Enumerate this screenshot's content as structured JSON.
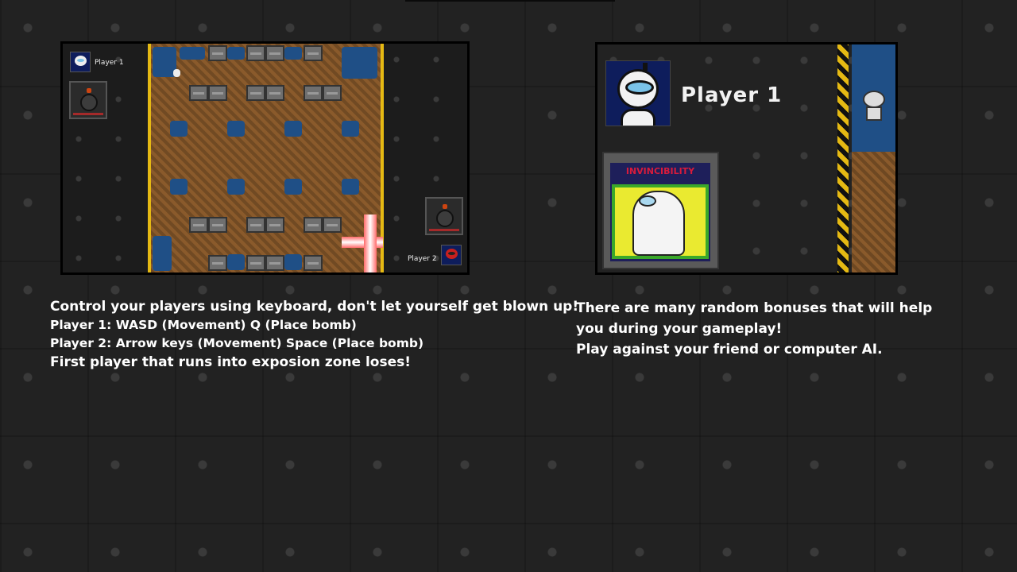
{
  "preview_left": {
    "player1_label": "Player 1",
    "player2_label": "Player 2"
  },
  "preview_right": {
    "player_title": "Player 1",
    "bonus_label": "INVINCIBILITY"
  },
  "instructions": {
    "line1": "Control your players using keyboard, don't let yourself get blown up!",
    "line2": "Player 1:  WASD (Movement) Q (Place bomb)",
    "line3": "Player 2: Arrow keys (Movement) Space (Place bomb)",
    "line4": "First player that runs into exposion zone loses!"
  },
  "bonuses_text": {
    "line1": "There are many random bonuses that will help you during your gameplay!",
    "line2": "Play against your friend or computer AI."
  },
  "colors": {
    "background": "#222222",
    "dirt": "#8a5a2b",
    "water": "#1f4f86",
    "hazard_yellow": "#e5b913",
    "text": "#ffffff"
  }
}
